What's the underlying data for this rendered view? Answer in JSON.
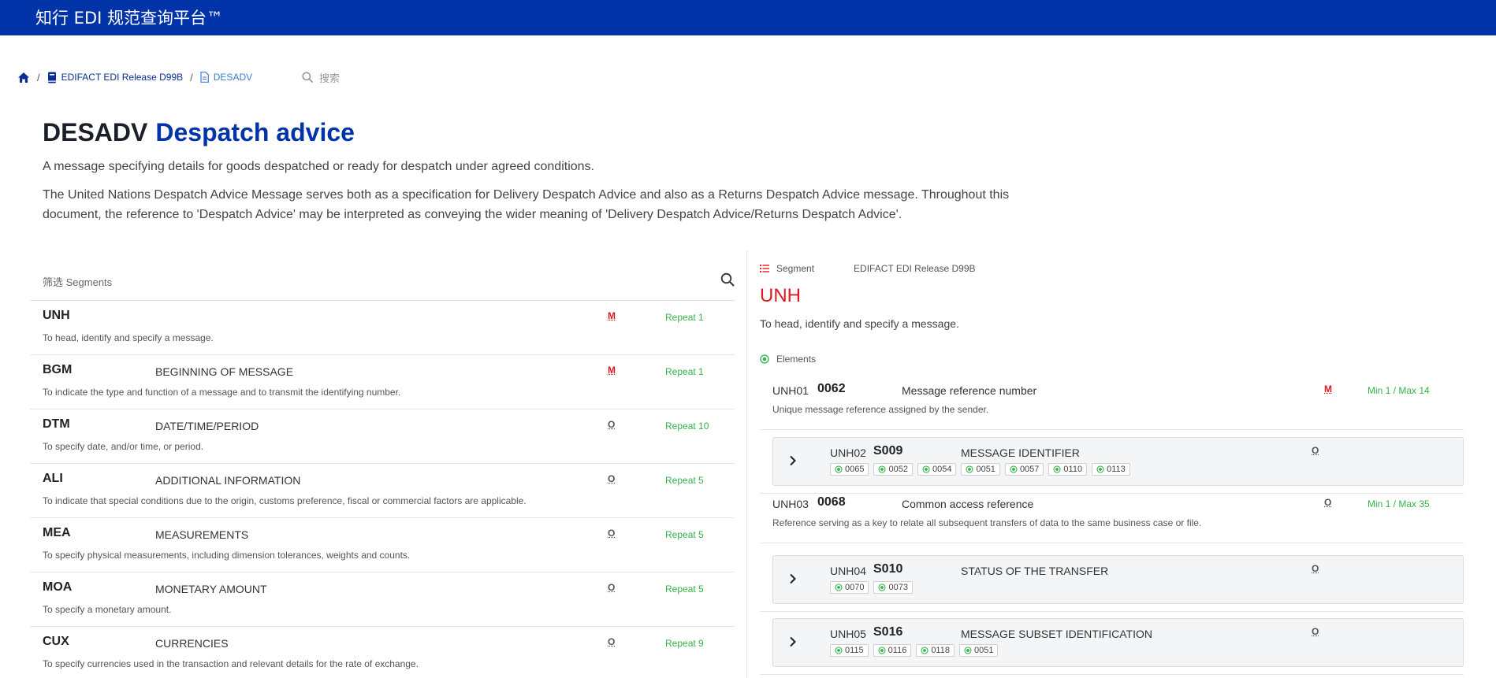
{
  "brand": {
    "title": "知行 EDI 规范查询平台™"
  },
  "breadcrumb": {
    "home_icon": "home-icon",
    "release_icon": "book-icon",
    "release": "EDIFACT EDI Release D99B",
    "current_icon": "file-icon",
    "current": "DESADV",
    "separator": "/"
  },
  "search": {
    "placeholder": "搜索",
    "icon": "search-icon"
  },
  "message": {
    "code": "DESADV",
    "name": "Despatch advice",
    "summary": "A message specifying details for goods despatched or ready for despatch under agreed conditions.",
    "description": "The United Nations Despatch Advice Message serves both as a specification for Delivery Despatch Advice and also as a Returns Despatch Advice message. Throughout this document, the reference to 'Despatch Advice' may be interpreted as conveying the wider meaning of 'Delivery Despatch Advice/Returns Despatch Advice'."
  },
  "filter": {
    "label_zh": "筛选",
    "label_en": " Segments",
    "icon": "search-icon"
  },
  "segments": [
    {
      "code": "UNH",
      "name": "",
      "req": "M",
      "repeat": "Repeat 1",
      "desc": "To head, identify and specify a message."
    },
    {
      "code": "BGM",
      "name": "BEGINNING OF MESSAGE",
      "req": "M",
      "repeat": "Repeat 1",
      "desc": "To indicate the type and function of a message and to transmit the identifying number."
    },
    {
      "code": "DTM",
      "name": "DATE/TIME/PERIOD",
      "req": "O",
      "repeat": "Repeat 10",
      "desc": "To specify date, and/or time, or period."
    },
    {
      "code": "ALI",
      "name": "ADDITIONAL INFORMATION",
      "req": "O",
      "repeat": "Repeat 5",
      "desc": "To indicate that special conditions due to the origin, customs preference, fiscal or commercial factors are applicable."
    },
    {
      "code": "MEA",
      "name": "MEASUREMENTS",
      "req": "O",
      "repeat": "Repeat 5",
      "desc": "To specify physical measurements, including dimension tolerances, weights and counts."
    },
    {
      "code": "MOA",
      "name": "MONETARY AMOUNT",
      "req": "O",
      "repeat": "Repeat 5",
      "desc": "To specify a monetary amount."
    },
    {
      "code": "CUX",
      "name": "CURRENCIES",
      "req": "O",
      "repeat": "Repeat 9",
      "desc": "To specify currencies used in the transaction and relevant details for the rate of exchange."
    }
  ],
  "detail": {
    "kind": "Segment",
    "kind_icon": "list-icon",
    "release": "EDIFACT EDI Release D99B",
    "code": "UNH",
    "desc": "To head, identify and specify a message.",
    "elements_label": "Elements",
    "elements_icon": "radio-dot-icon",
    "elements": [
      {
        "pos": "UNH01",
        "code": "0062",
        "name": "Message reference number",
        "req": "M",
        "minmax": "Min 1 / Max 14",
        "desc": "Unique message reference assigned by the sender."
      },
      {
        "pos": "UNH02",
        "code": "S009",
        "name": "MESSAGE IDENTIFIER",
        "req": "O",
        "chips": [
          "0065",
          "0052",
          "0054",
          "0051",
          "0057",
          "0110",
          "0113"
        ]
      },
      {
        "pos": "UNH03",
        "code": "0068",
        "name": "Common access reference",
        "req": "O",
        "minmax": "Min 1 / Max 35",
        "desc": "Reference serving as a key to relate all subsequent transfers of data to the same business case or file."
      },
      {
        "pos": "UNH04",
        "code": "S010",
        "name": "STATUS OF THE TRANSFER",
        "req": "O",
        "chips": [
          "0070",
          "0073"
        ]
      },
      {
        "pos": "UNH05",
        "code": "S016",
        "name": "MESSAGE SUBSET IDENTIFICATION",
        "req": "O",
        "chips": [
          "0115",
          "0116",
          "0118",
          "0051"
        ]
      }
    ]
  },
  "colors": {
    "brand_blue": "#0033a8",
    "mandatory_red": "#d8191e",
    "repeat_green": "#34b24a"
  }
}
